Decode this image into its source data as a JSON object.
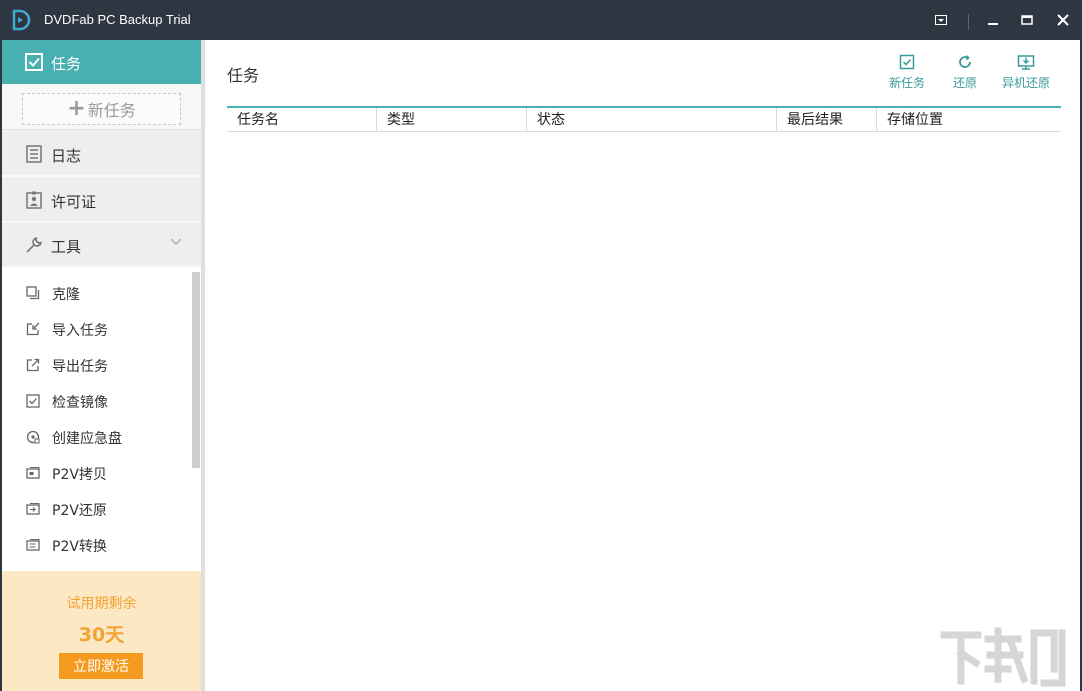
{
  "window": {
    "title": "DVDFab PC Backup Trial"
  },
  "sidebar": {
    "active": {
      "label": "任务"
    },
    "new_task": {
      "label": "新任务"
    },
    "items": [
      {
        "label": "日志"
      },
      {
        "label": "许可证"
      },
      {
        "label": "工具"
      }
    ],
    "tools": [
      {
        "label": "克隆"
      },
      {
        "label": "导入任务"
      },
      {
        "label": "导出任务"
      },
      {
        "label": "检查镜像"
      },
      {
        "label": "创建应急盘"
      },
      {
        "label": "P2V拷贝"
      },
      {
        "label": "P2V还原"
      },
      {
        "label": "P2V转换"
      }
    ],
    "trial": {
      "text": "试用期剩余",
      "days": "30天",
      "activate_label": "立即激活"
    }
  },
  "main": {
    "title": "任务",
    "actions": [
      {
        "label": "新任务"
      },
      {
        "label": "还原"
      },
      {
        "label": "异机还原"
      }
    ],
    "columns": [
      "任务名",
      "类型",
      "状态",
      "最后结果",
      "存储位置"
    ]
  },
  "colors": {
    "accent": "#48b0b0",
    "titlebar": "#2d3641",
    "trial_bg": "#fde8c6",
    "trial_text": "#f2a331",
    "activate_btn": "#f49b1f"
  }
}
